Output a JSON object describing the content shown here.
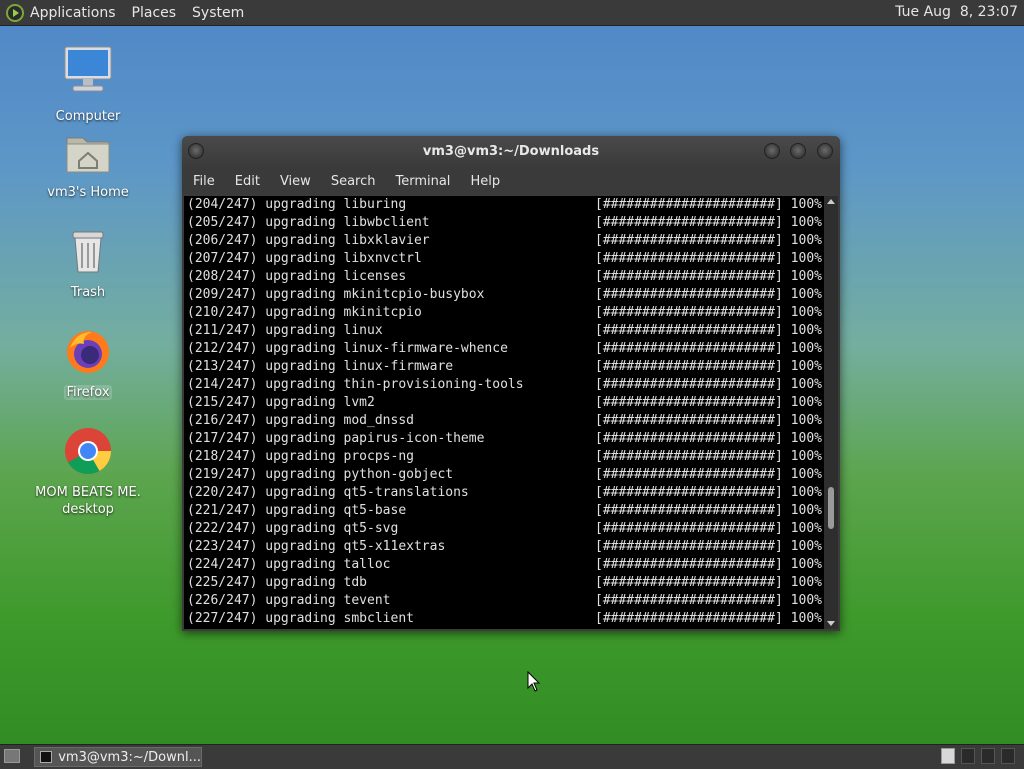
{
  "top_panel": {
    "menus": [
      "Applications",
      "Places",
      "System"
    ],
    "clock": "Tue Aug  8, 23:07"
  },
  "desktop_icons": [
    {
      "label": "Computer",
      "icon": "computer-icon"
    },
    {
      "label": "vm3's Home",
      "icon": "home-folder-icon"
    },
    {
      "label": "Trash",
      "icon": "trash-icon"
    },
    {
      "label": "Firefox",
      "icon": "firefox-icon"
    },
    {
      "label": "MOM BEATS ME.\ndesktop",
      "icon": "chrome-icon"
    }
  ],
  "window": {
    "title": "vm3@vm3:~/Downloads",
    "menu": [
      "File",
      "Edit",
      "View",
      "Search",
      "Terminal",
      "Help"
    ]
  },
  "terminal": {
    "progress_bar": "[######################]",
    "percent": "100%",
    "lines": [
      "(204/247) upgrading liburing",
      "(205/247) upgrading libwbclient",
      "(206/247) upgrading libxklavier",
      "(207/247) upgrading libxnvctrl",
      "(208/247) upgrading licenses",
      "(209/247) upgrading mkinitcpio-busybox",
      "(210/247) upgrading mkinitcpio",
      "(211/247) upgrading linux",
      "(212/247) upgrading linux-firmware-whence",
      "(213/247) upgrading linux-firmware",
      "(214/247) upgrading thin-provisioning-tools",
      "(215/247) upgrading lvm2",
      "(216/247) upgrading mod_dnssd",
      "(217/247) upgrading papirus-icon-theme",
      "(218/247) upgrading procps-ng",
      "(219/247) upgrading python-gobject",
      "(220/247) upgrading qt5-translations",
      "(221/247) upgrading qt5-base",
      "(222/247) upgrading qt5-svg",
      "(223/247) upgrading qt5-x11extras",
      "(224/247) upgrading talloc",
      "(225/247) upgrading tdb",
      "(226/247) upgrading tevent",
      "(227/247) upgrading smbclient"
    ]
  },
  "taskbar": {
    "task_label": "vm3@vm3:~/Downl..."
  }
}
